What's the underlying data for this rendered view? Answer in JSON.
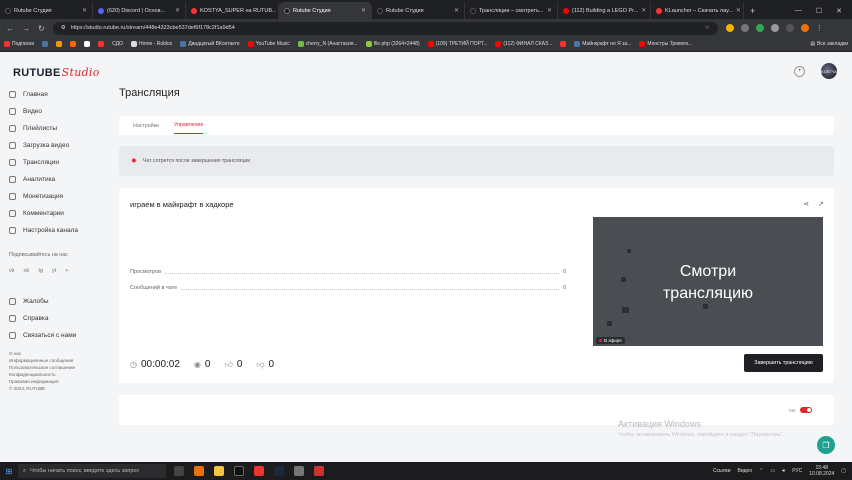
{
  "browser": {
    "tabs": [
      {
        "label": "Rutube Студия",
        "color": "#1c1c1c",
        "active": false
      },
      {
        "label": "(620) Discord | Основ...",
        "color": "#5865f2",
        "active": false
      },
      {
        "label": "KOSTYA_SUPER на RUTUB...",
        "color": "#ff3333",
        "active": false
      },
      {
        "label": "Rutube Студия",
        "color": "#1c1c1c",
        "active": true
      },
      {
        "label": "Rutube Студия",
        "color": "#1c1c1c",
        "active": false
      },
      {
        "label": "Трансляции – смотреть...",
        "color": "#1c1c1c",
        "active": false
      },
      {
        "label": "(112) Building a LEGO Pr...",
        "color": "#ff0000",
        "active": false
      },
      {
        "label": "KLauncher – Скачать лау...",
        "color": "#ff3333",
        "active": false
      }
    ],
    "url": "https://studio.rutube.ru/stream/448e4323cbe537def6f178c2f1a9d54",
    "bookmarks": [
      {
        "label": "Подписки",
        "color": "#ff3333"
      },
      {
        "label": "",
        "color": "#4a76a8"
      },
      {
        "label": "",
        "color": "#ff9900"
      },
      {
        "label": "",
        "color": "#ff6600"
      },
      {
        "label": "",
        "color": "#ffffff"
      },
      {
        "label": "",
        "color": "#ff3333"
      },
      {
        "label": "СДО",
        "color": "#555555"
      },
      {
        "label": "Home - Roblox",
        "color": "#dddddd"
      },
      {
        "label": "Двадцатый ВКонтакте",
        "color": "#4a76a8"
      },
      {
        "label": "YouTube Music",
        "color": "#ff0000"
      },
      {
        "label": "cherry_N (Анастасия...",
        "color": "#6fbf4a"
      },
      {
        "label": "file.php (3264×2448)",
        "color": "#88cc44"
      },
      {
        "label": "(109) ТРЕТИЙ ПОРТ...",
        "color": "#ff0000"
      },
      {
        "label": "(112) ФИНАЛ СКАЗ...",
        "color": "#ff0000"
      },
      {
        "label": "",
        "color": "#ff3333"
      },
      {
        "label": "Майнкрафт но Я за...",
        "color": "#4a76a8"
      },
      {
        "label": "Монстры Тревоги...",
        "color": "#ff0000"
      }
    ],
    "all_bookmarks": "Все закладки"
  },
  "app": {
    "logo_main": "RUTUBE",
    "logo_accent": "Studio",
    "avatar_text": "KOSTYA"
  },
  "sidebar": {
    "items": [
      {
        "label": "Главная"
      },
      {
        "label": "Видео"
      },
      {
        "label": "Плейлисты"
      },
      {
        "label": "Загрузка видео"
      },
      {
        "label": "Трансляции"
      },
      {
        "label": "Аналитика"
      },
      {
        "label": "Монетизация"
      },
      {
        "label": "Комментарии"
      },
      {
        "label": "Настройка канала"
      }
    ],
    "subscribe_title": "Подписывайтесь на нас",
    "socials": [
      "vk",
      "ok",
      "tg",
      "yt",
      "+"
    ],
    "bottom_items": [
      {
        "label": "Жалобы"
      },
      {
        "label": "Справка"
      },
      {
        "label": "Связаться с нами"
      }
    ],
    "footer": [
      "О нас",
      "Информационные сообщения",
      "Пользовательское соглашение",
      "Конфиденциальность",
      "Правовая информация",
      "© 2024, RUTUBE"
    ]
  },
  "page": {
    "title": "Трансляция",
    "tabs": [
      {
        "label": "Настройки",
        "active": false
      },
      {
        "label": "Управление",
        "active": true
      }
    ],
    "alert": "Чат сотрется после завершения трансляции"
  },
  "stream": {
    "title": "играем в майкрафт в хадкоре",
    "stats": [
      {
        "label": "Просмотров",
        "value": "0"
      },
      {
        "label": "Сообщений в чате",
        "value": "0"
      }
    ],
    "duration": "00:00:02",
    "viewers": "0",
    "likes": "0",
    "dislikes": "0",
    "preview_text_1": "Смотри",
    "preview_text_2": "трансляцию",
    "live_badge": "В эфире",
    "end_button": "Завершить трансляцию",
    "chat_label": "Чат"
  },
  "windows": {
    "activation_title": "Активация Windows",
    "activation_sub": "Чтобы активировать Windows, перейдите в раздел \"Параметры\".",
    "search_placeholder": "Чтобы начать поиск, введите здесь запрос",
    "tray_links": "Ссылки",
    "tray_video": "Видео",
    "lang": "РУС",
    "time": "15:48",
    "date": "10.08.2024"
  },
  "colors": {
    "accent": "#e3252d",
    "dark": "#1f2023",
    "fab": "#20a08e"
  }
}
